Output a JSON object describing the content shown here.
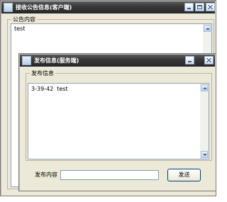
{
  "client_window": {
    "title": "接收公告信息(客户端)",
    "group_label": "公告内容",
    "lines": [
      "test"
    ]
  },
  "server_window": {
    "title": "发布信息(服务端)",
    "group_label": "发布信息",
    "lines": [
      "3-39-42  test"
    ],
    "input_label": "发布内容",
    "input_value": "",
    "send_label": "发送"
  }
}
